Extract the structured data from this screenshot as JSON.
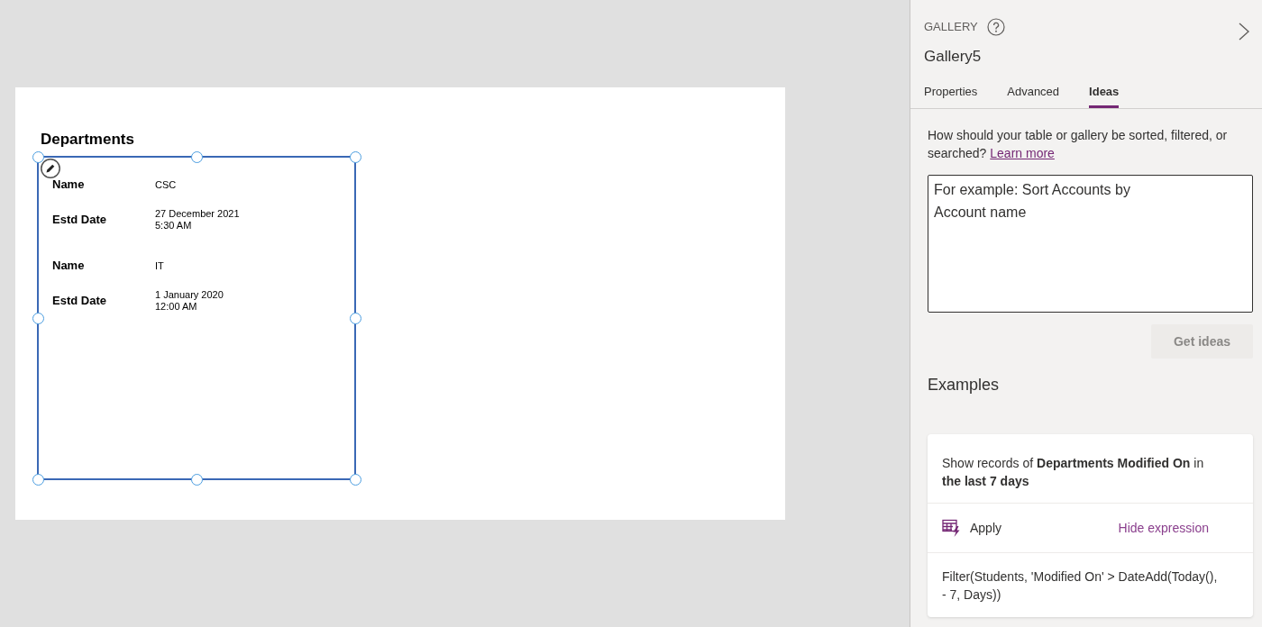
{
  "canvas": {
    "screen": {
      "title": "Departments",
      "gallery": {
        "selected": true,
        "items": [
          {
            "fields": [
              {
                "label": "Name",
                "value": "CSC"
              },
              {
                "label": "Estd Date",
                "value": "27 December 2021\n5:30 AM"
              }
            ]
          },
          {
            "fields": [
              {
                "label": "Name",
                "value": "IT"
              },
              {
                "label": "Estd Date",
                "value": "1 January 2020\n12:00 AM"
              }
            ]
          }
        ]
      }
    }
  },
  "panel": {
    "control_type": "GALLERY",
    "control_name": "Gallery5",
    "tabs": [
      {
        "label": "Properties",
        "selected": false
      },
      {
        "label": "Advanced",
        "selected": false
      },
      {
        "label": "Ideas",
        "selected": true
      }
    ],
    "ideas": {
      "prompt": "How should your table or gallery be sorted, filtered, or searched?",
      "link": "Learn more",
      "input": {
        "placeholder": "For example: Sort Accounts by Account name"
      },
      "get_ideas_button": {
        "label": "Get ideas",
        "disabled": true
      },
      "examples_title": "Examples",
      "examples": [
        {
          "description": "Show records of **Departments Modified On** in **the last 7 days**",
          "action": "Apply",
          "toggle": "Hide expression",
          "expression": "Filter(Students, 'Modified On' > DateAdd(Today(), - 7, Days))"
        }
      ]
    }
  }
}
